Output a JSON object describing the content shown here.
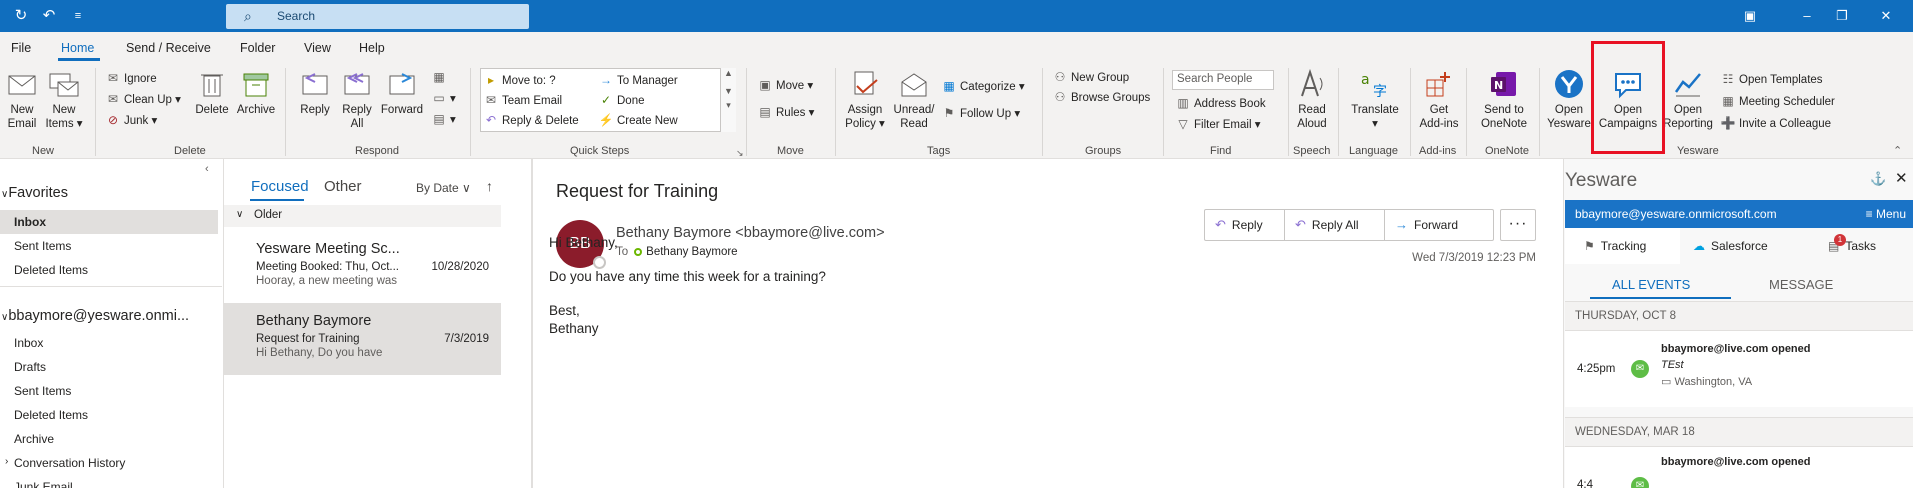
{
  "titlebar": {
    "search_placeholder": "Search"
  },
  "menu": {
    "tabs": [
      "File",
      "Home",
      "Send / Receive",
      "Folder",
      "View",
      "Help"
    ],
    "active": "Home"
  },
  "ribbon": {
    "groups": {
      "new": "New",
      "delete": "Delete",
      "respond": "Respond",
      "quick_steps": "Quick Steps",
      "move": "Move",
      "tags": "Tags",
      "groups": "Groups",
      "find": "Find",
      "speech": "Speech",
      "language": "Language",
      "addins": "Add-ins",
      "onenote": "OneNote",
      "yesware": "Yesware"
    },
    "new_email": [
      "New",
      "Email"
    ],
    "new_items": [
      "New",
      "Items"
    ],
    "ignore": "Ignore",
    "clean_up": "Clean Up",
    "junk": "Junk",
    "delete": "Delete",
    "archive": "Archive",
    "reply": "Reply",
    "reply_all": [
      "Reply",
      "All"
    ],
    "forward": "Forward",
    "quick_steps": {
      "move_to": "Move to: ?",
      "to_manager": "To Manager",
      "team_email": "Team Email",
      "done": "Done",
      "reply_delete": "Reply & Delete",
      "create_new": "Create New"
    },
    "move": "Move",
    "rules": "Rules",
    "assign_policy": [
      "Assign",
      "Policy"
    ],
    "unread_read": [
      "Unread/",
      "Read"
    ],
    "categorize": "Categorize",
    "follow_up": "Follow Up",
    "new_group": "New Group",
    "browse_groups": "Browse Groups",
    "search_people": "Search People",
    "address_book": "Address Book",
    "filter_email": "Filter Email",
    "read_aloud": [
      "Read",
      "Aloud"
    ],
    "translate": "Translate",
    "get_addins": [
      "Get",
      "Add-ins"
    ],
    "send_onenote": [
      "Send to",
      "OneNote"
    ],
    "open_yesware": [
      "Open",
      "Yesware"
    ],
    "open_campaigns": [
      "Open",
      "Campaigns"
    ],
    "open_reporting": [
      "Open",
      "Reporting"
    ],
    "open_templates": "Open Templates",
    "meeting_scheduler": "Meeting Scheduler",
    "invite_colleague": "Invite a Colleague"
  },
  "nav": {
    "favorites_header": "Favorites",
    "favorites": [
      "Inbox",
      "Sent Items",
      "Deleted Items"
    ],
    "account_header": "bbaymore@yesware.onmi...",
    "account_folders": [
      "Inbox",
      "Drafts",
      "Sent Items",
      "Deleted Items",
      "Archive",
      "Conversation History",
      "Junk Email"
    ]
  },
  "msglist": {
    "tab_focused": "Focused",
    "tab_other": "Other",
    "sort": "By Date",
    "group_older": "Older",
    "messages": [
      {
        "from": "Yesware Meeting Sc...",
        "subject": "Meeting Booked: Thu, Oct...",
        "preview": "Hooray, a new meeting was",
        "date": "10/28/2020"
      },
      {
        "from": "Bethany Baymore",
        "subject": "Request for Training",
        "preview": "Hi Bethany,  Do you have",
        "date": "7/3/2019"
      }
    ]
  },
  "reading": {
    "subject": "Request for Training",
    "avatar_initials": "BB",
    "sender": "Bethany Baymore <bbaymore@live.com>",
    "to_label": "To",
    "to_name": "Bethany Baymore",
    "reply": "Reply",
    "reply_all": "Reply All",
    "forward": "Forward",
    "more": "···",
    "date": "Wed 7/3/2019 12:23 PM",
    "body": [
      "Hi Bethany,",
      "Do you have any time this week for a training?",
      "Best,",
      "Bethany"
    ]
  },
  "yesware": {
    "title": "Yesware",
    "email": "bbaymore@yesware.onmicrosoft.com",
    "menu": "Menu",
    "tabs": [
      "Tracking",
      "Salesforce",
      "Tasks"
    ],
    "tasks_badge": "1",
    "subtabs": [
      "ALL EVENTS",
      "MESSAGE"
    ],
    "days": [
      {
        "label": "THURSDAY, OCT 8",
        "events": [
          {
            "time": "4:25pm",
            "title": "bbaymore@live.com opened",
            "subtitle": "TEst",
            "location": "Washington, VA"
          }
        ]
      },
      {
        "label": "WEDNESDAY, MAR 18",
        "events": [
          {
            "time": "4:4",
            "title": "bbaymore@live.com opened",
            "subtitle": "",
            "location": ""
          }
        ]
      }
    ]
  }
}
